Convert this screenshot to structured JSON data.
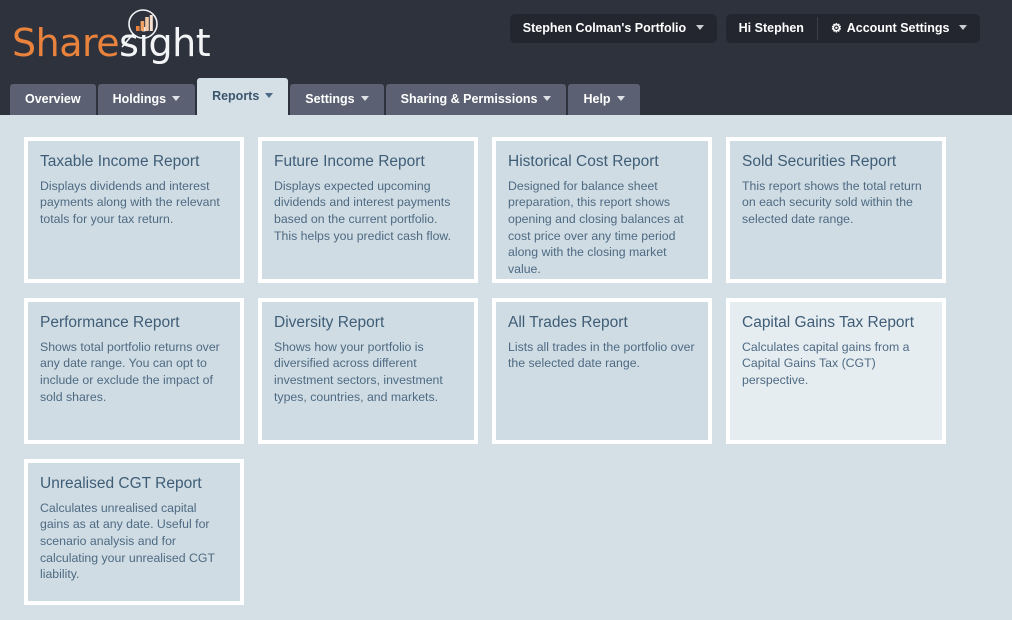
{
  "brand": {
    "name_primary": "Share",
    "name_secondary": "sight",
    "logo_icon": "magnifier-bar-chart-icon",
    "accent_color": "#e8823c"
  },
  "header": {
    "portfolio_button": "Stephen Colman's Portfolio",
    "greeting": "Hi Stephen",
    "account_settings": "Account Settings",
    "gear_glyph": "⚙",
    "caret_glyph": "▾"
  },
  "nav": {
    "tabs": [
      {
        "label": "Overview",
        "has_caret": false,
        "active": false
      },
      {
        "label": "Holdings",
        "has_caret": true,
        "active": false
      },
      {
        "label": "Reports",
        "has_caret": true,
        "active": true
      },
      {
        "label": "Settings",
        "has_caret": true,
        "active": false
      },
      {
        "label": "Sharing & Permissions",
        "has_caret": true,
        "active": false
      },
      {
        "label": "Help",
        "has_caret": true,
        "active": false
      }
    ]
  },
  "reports": [
    {
      "title": "Taxable Income Report",
      "description": "Displays dividends and interest payments along with the relevant totals for your tax return.",
      "hovered": false
    },
    {
      "title": "Future Income Report",
      "description": "Displays expected upcoming dividends and interest payments based on the current portfolio. This helps you predict cash flow.",
      "hovered": false
    },
    {
      "title": "Historical Cost Report",
      "description": "Designed for balance sheet preparation, this report shows opening and closing balances at cost price over any time period along with the closing market value.",
      "hovered": false
    },
    {
      "title": "Sold Securities Report",
      "description": "This report shows the total return on each security sold within the selected date range.",
      "hovered": false
    },
    {
      "title": "Performance Report",
      "description": "Shows total portfolio returns over any date range. You can opt to include or exclude the impact of sold shares.",
      "hovered": false
    },
    {
      "title": "Diversity Report",
      "description": "Shows how your portfolio is diversified across different investment sectors, investment types, countries, and markets.",
      "hovered": false
    },
    {
      "title": "All Trades Report",
      "description": "Lists all trades in the portfolio over the selected date range.",
      "hovered": false
    },
    {
      "title": "Capital Gains Tax Report",
      "description": "Calculates capital gains from a Capital Gains Tax (CGT) perspective.",
      "hovered": true
    },
    {
      "title": "Unrealised CGT Report",
      "description": "Calculates unrealised capital gains as at any date. Useful for scenario analysis and for calculating your unrealised CGT liability.",
      "hovered": false
    }
  ],
  "colors": {
    "page_background": "#d4e0e6",
    "chrome_dark": "#2e323c",
    "card_background": "#cfdce3",
    "card_background_hover": "#e6edf1",
    "title_text": "#3f5d77"
  }
}
